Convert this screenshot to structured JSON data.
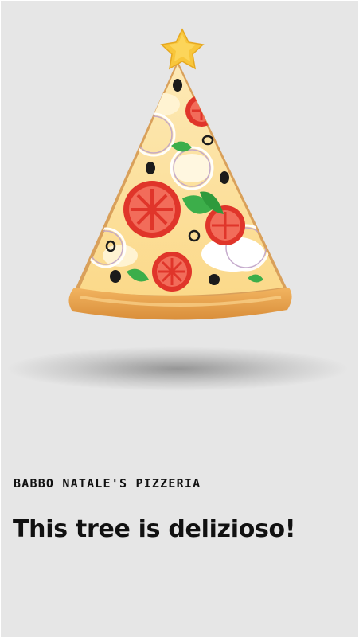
{
  "card": {
    "background_color": "#e6e6e6",
    "illustration": {
      "name": "pizza-slice-christmas-tree",
      "topper": "star-icon",
      "toppings": [
        "tomato-slice",
        "olive",
        "basil-leaf",
        "onion-ring",
        "mozzarella"
      ]
    },
    "kicker": "BABBO NATALE'S PIZZERIA",
    "headline": "This tree is delizioso!"
  }
}
